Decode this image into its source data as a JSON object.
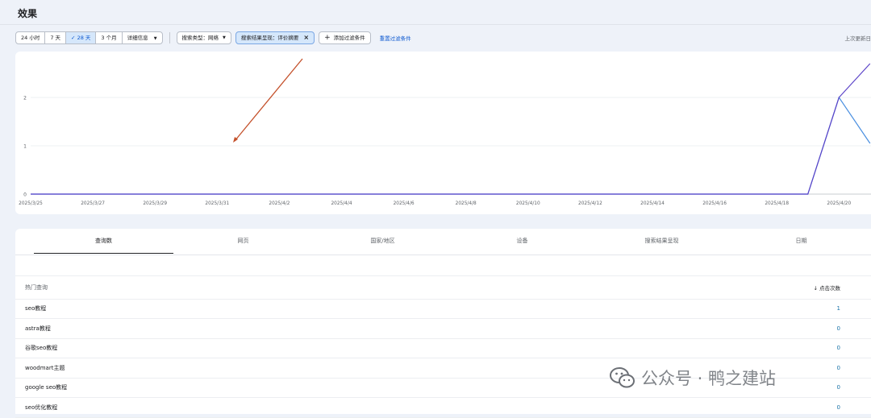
{
  "page": {
    "title": "效果",
    "last_updated": "上次更新日"
  },
  "toolbar": {
    "ranges": [
      {
        "label": "24 小时",
        "active": false
      },
      {
        "label": "7 天",
        "active": false
      },
      {
        "label": "28 天",
        "active": true
      },
      {
        "label": "3 个月",
        "active": false
      },
      {
        "label": "详细信息",
        "active": false
      }
    ],
    "search_type": "搜索类型：网络",
    "appearance_filter": "搜索结果呈现：评价摘要",
    "add_filter": "添加过滤条件",
    "reset": "重置过滤条件"
  },
  "chart_data": {
    "type": "line",
    "title": "",
    "xlabel": "",
    "ylabel": "",
    "y_ticks": [
      "0",
      "1",
      "2"
    ],
    "ylim": [
      0,
      2.7
    ],
    "x": [
      "2025/3/25",
      "2025/3/26",
      "2025/3/27",
      "2025/3/28",
      "2025/3/29",
      "2025/3/30",
      "2025/3/31",
      "2025/4/1",
      "2025/4/2",
      "2025/4/3",
      "2025/4/4",
      "2025/4/5",
      "2025/4/6",
      "2025/4/7",
      "2025/4/8",
      "2025/4/9",
      "2025/4/10",
      "2025/4/11",
      "2025/4/12",
      "2025/4/13",
      "2025/4/14",
      "2025/4/15",
      "2025/4/16",
      "2025/4/17",
      "2025/4/18",
      "2025/4/19",
      "2025/4/20",
      "2025/4/21"
    ],
    "x_tick_labels": [
      "2025/3/25",
      "2025/3/27",
      "2025/3/29",
      "2025/3/31",
      "2025/4/2",
      "2025/4/4",
      "2025/4/6",
      "2025/4/8",
      "2025/4/10",
      "2025/4/12",
      "2025/4/14",
      "2025/4/16",
      "2025/4/18",
      "2025/4/20"
    ],
    "series": [
      {
        "color": "#4a8fe0",
        "values": [
          0,
          0,
          0,
          0,
          0,
          0,
          0,
          0,
          0,
          0,
          0,
          0,
          0,
          0,
          0,
          0,
          0,
          0,
          0,
          0,
          0,
          0,
          0,
          0,
          0,
          0,
          2,
          1.05
        ]
      },
      {
        "color": "#5b43c8",
        "values": [
          0,
          0,
          0,
          0,
          0,
          0,
          0,
          0,
          0,
          0,
          0,
          0,
          0,
          0,
          0,
          0,
          0,
          0,
          0,
          0,
          0,
          0,
          0,
          0,
          0,
          0,
          2,
          2.7
        ]
      }
    ]
  },
  "tabs": [
    {
      "label": "查询数",
      "active": true
    },
    {
      "label": "网页",
      "active": false
    },
    {
      "label": "国家/地区",
      "active": false
    },
    {
      "label": "设备",
      "active": false
    },
    {
      "label": "搜索结果呈现",
      "active": false
    },
    {
      "label": "日期",
      "active": false
    }
  ],
  "table": {
    "header_query": "热门查询",
    "header_clicks": "点击次数",
    "rows": [
      {
        "query": "seo教程",
        "clicks": "1"
      },
      {
        "query": "astra教程",
        "clicks": "0"
      },
      {
        "query": "谷歌seo教程",
        "clicks": "0"
      },
      {
        "query": "woodmart主题",
        "clicks": "0"
      },
      {
        "query": "google seo教程",
        "clicks": "0"
      },
      {
        "query": "seo优化教程",
        "clicks": "0"
      }
    ]
  },
  "watermark": {
    "text": "公众号 · 鸭之建站"
  },
  "colors": {
    "accent": "#0b57d0",
    "annotation_arrow": "#c4502a"
  }
}
